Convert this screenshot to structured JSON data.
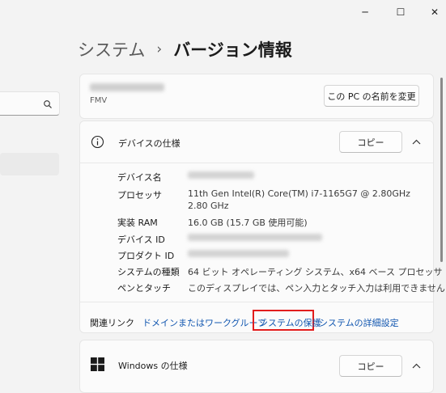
{
  "window": {
    "minimize_glyph": "─",
    "maximize_glyph": "☐",
    "close_glyph": "✕"
  },
  "breadcrumb": {
    "parent": "システム",
    "separator": "›",
    "current": "バージョン情報"
  },
  "pc_card": {
    "model": "FMV",
    "rename_button": "この PC の名前を変更"
  },
  "device_specs": {
    "title": "デバイスの仕様",
    "copy_button": "コピー",
    "rows": [
      {
        "label": "デバイス名",
        "value": ""
      },
      {
        "label": "プロセッサ",
        "value": "11th Gen Intel(R) Core(TM) i7-1165G7 @ 2.80GHz",
        "value2": "2.80 GHz"
      },
      {
        "label": "実装 RAM",
        "value": "16.0 GB (15.7 GB 使用可能)"
      },
      {
        "label": "デバイス ID",
        "value": ""
      },
      {
        "label": "プロダクト ID",
        "value": ""
      },
      {
        "label": "システムの種類",
        "value": "64 ビット オペレーティング システム、x64 ベース プロセッサ"
      },
      {
        "label": "ペンとタッチ",
        "value": "このディスプレイでは、ペン入力とタッチ入力は利用できません"
      }
    ]
  },
  "related_links": {
    "label": "関連リンク",
    "links": [
      "ドメインまたはワークグループ",
      "システムの保護",
      "システムの詳細設定"
    ]
  },
  "windows_specs": {
    "title": "Windows の仕様",
    "copy_button": "コピー"
  },
  "colors": {
    "link": "#1257b0",
    "highlight_box": "#e21d1d",
    "background": "#f3f3f3",
    "card": "#fbfbfb"
  },
  "icons": [
    "minimize-icon",
    "maximize-icon",
    "close-icon",
    "search-icon",
    "info-icon",
    "chevron-up-icon",
    "windows-logo-icon"
  ]
}
